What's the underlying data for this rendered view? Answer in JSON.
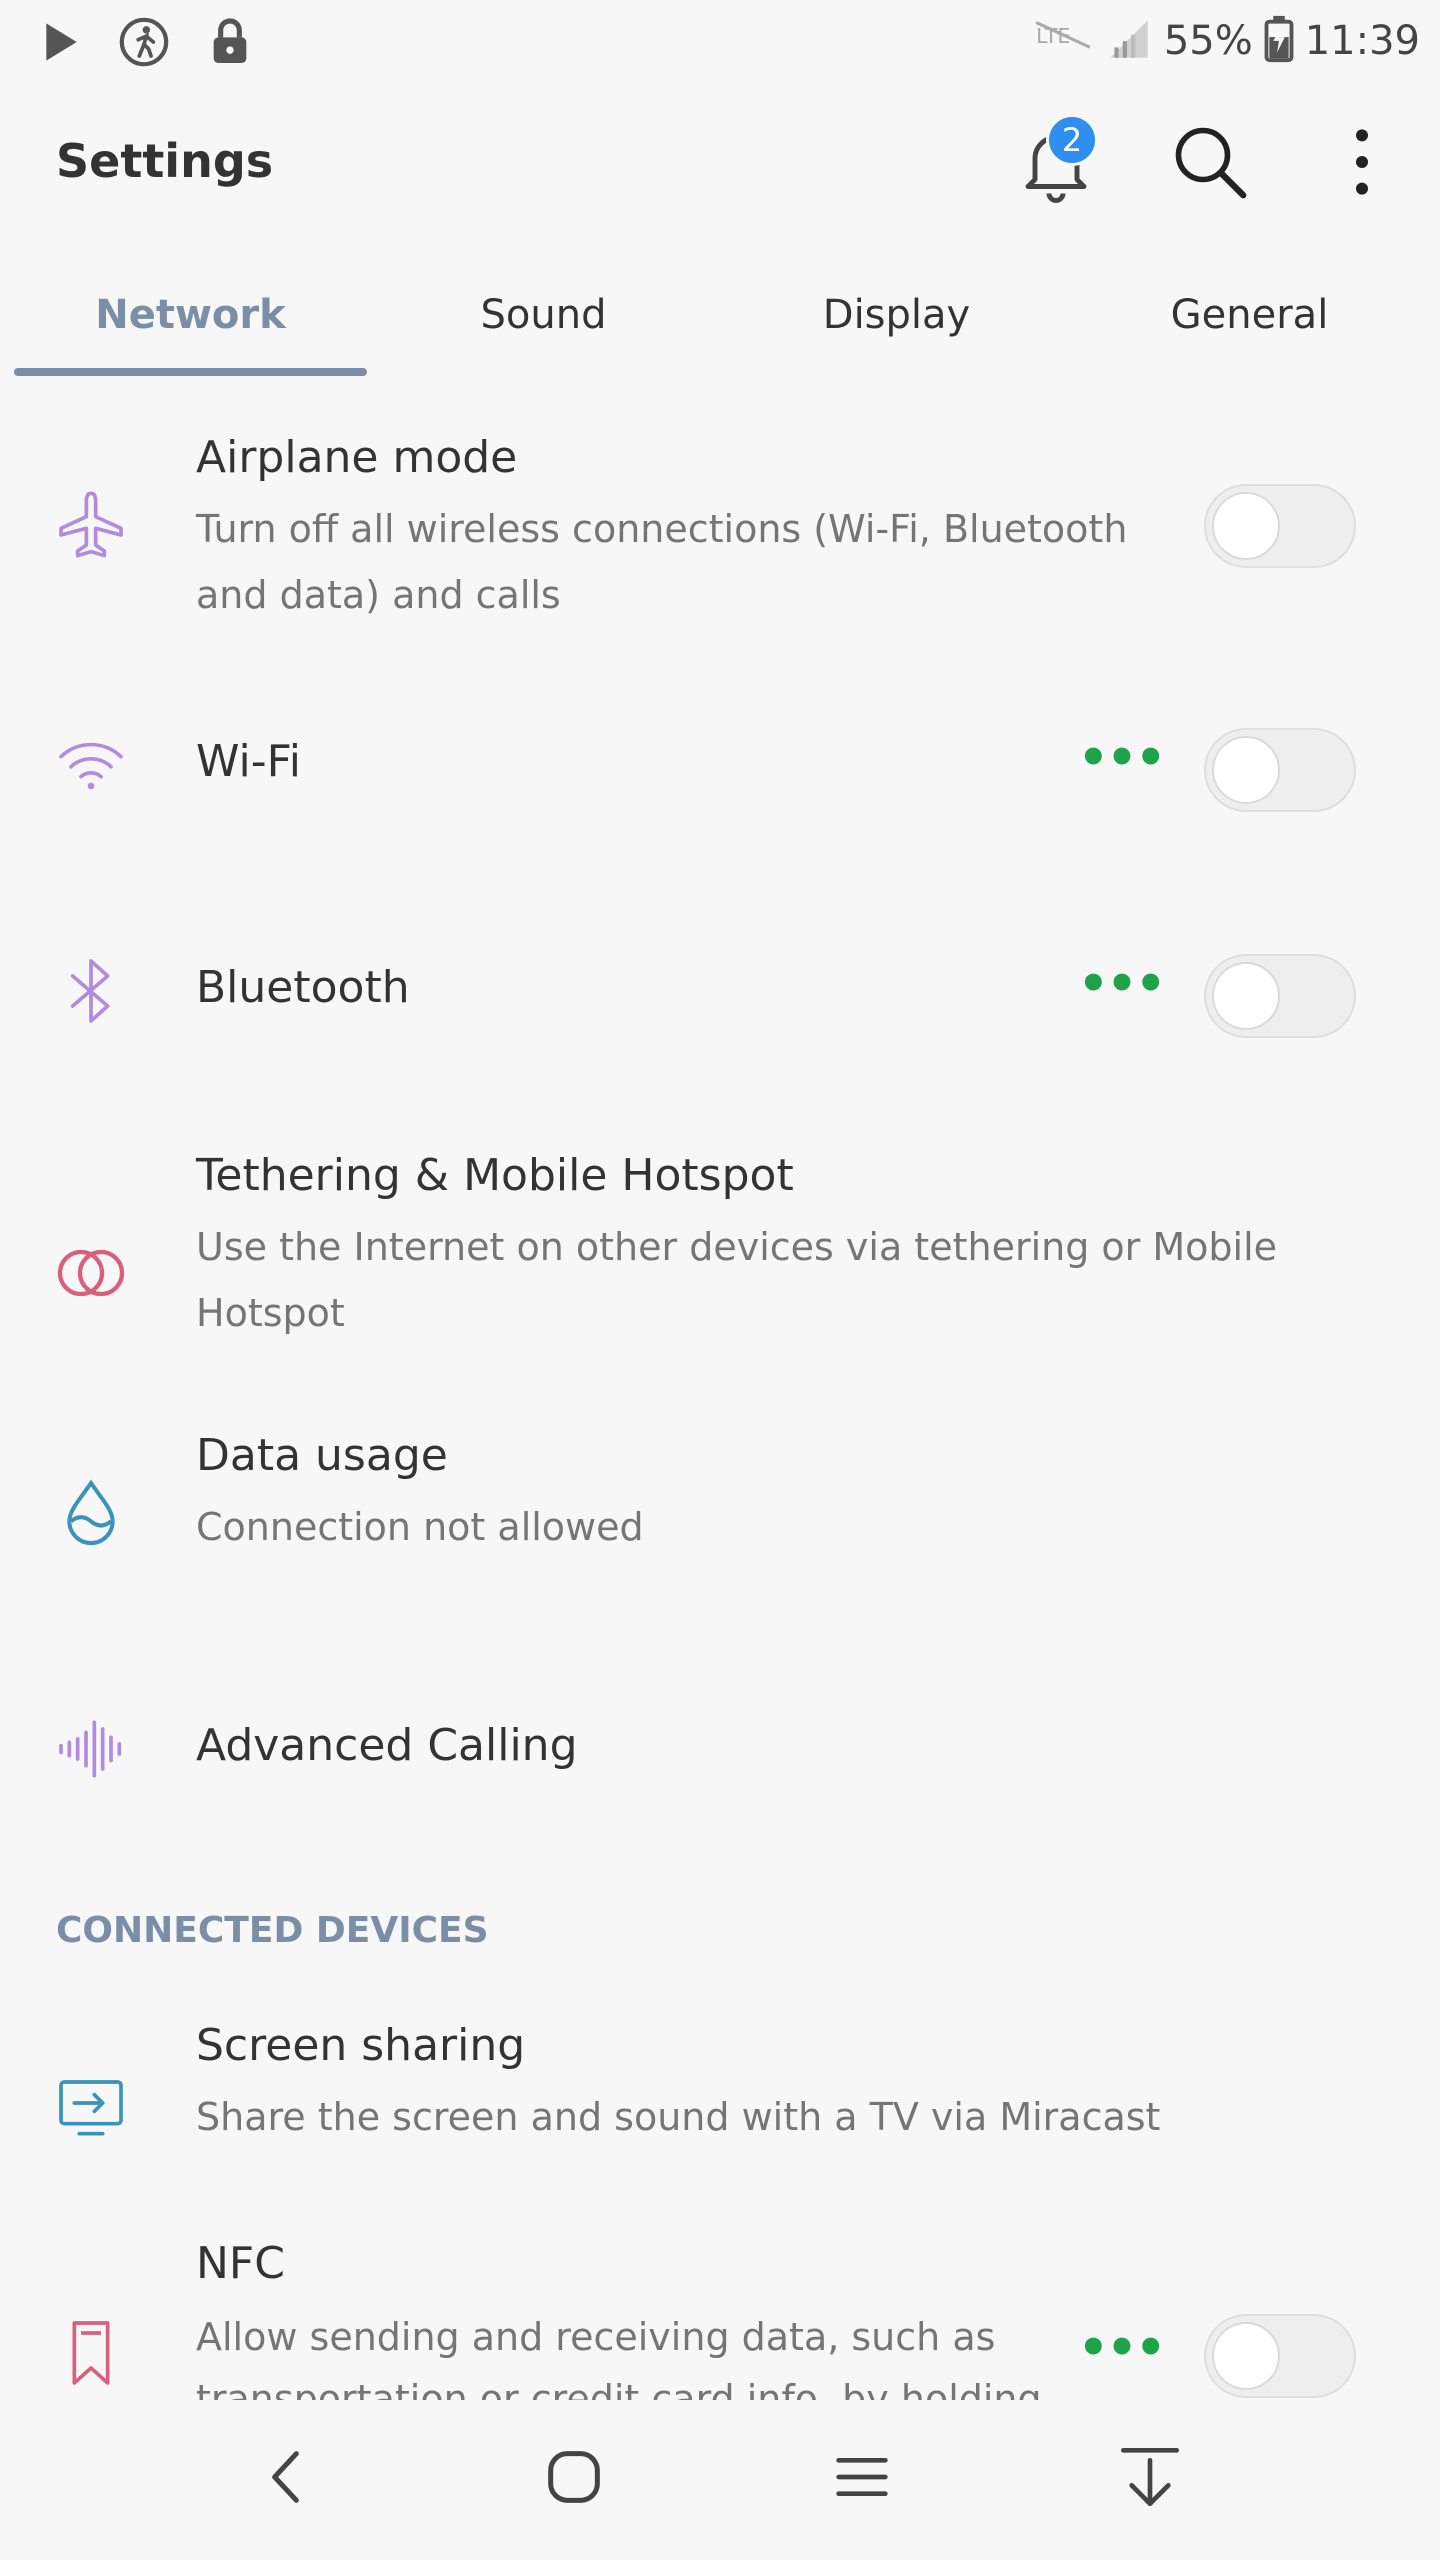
{
  "status_bar": {
    "battery": "55%",
    "time": "11:39"
  },
  "header": {
    "title": "Settings",
    "notification_count": "2"
  },
  "tabs": [
    {
      "label": "Network",
      "active": true
    },
    {
      "label": "Sound",
      "active": false
    },
    {
      "label": "Display",
      "active": false
    },
    {
      "label": "General",
      "active": false
    }
  ],
  "items": {
    "airplane": {
      "title": "Airplane mode",
      "subtitle_line1": "Turn off all wireless connections (Wi-Fi, Bluetooth",
      "subtitle_line2": "and data) and calls",
      "toggle": false
    },
    "wifi": {
      "title": "Wi-Fi",
      "more": "•••",
      "toggle": false
    },
    "bluetooth": {
      "title": "Bluetooth",
      "more": "•••",
      "toggle": false
    },
    "tethering": {
      "title": "Tethering & Mobile Hotspot",
      "subtitle_line1": "Use the Internet on other devices via tethering or Mobile",
      "subtitle_line2": "Hotspot"
    },
    "data_usage": {
      "title": "Data usage",
      "subtitle": "Connection not allowed"
    },
    "advanced_calling": {
      "title": "Advanced Calling"
    }
  },
  "section_connected": {
    "header": "CONNECTED DEVICES",
    "screen_sharing": {
      "title": "Screen sharing",
      "subtitle": "Share the screen and sound with a TV via Miracast"
    },
    "nfc": {
      "title": "NFC",
      "subtitle_line1": "Allow sending and receiving data, such as",
      "subtitle_line2": "transportation or credit card info, by holding",
      "more": "•••",
      "toggle": false
    }
  },
  "colors": {
    "accent": "#7a8ea7",
    "icon_purple": "#b08be0",
    "icon_pink": "#d9607a",
    "icon_teal": "#3a93b8",
    "more_green": "#1fa34a",
    "badge_blue": "#2f8ff0"
  },
  "icons": [
    "play-icon",
    "activity-icon",
    "lock-icon",
    "no-sim-icon",
    "signal-icon",
    "battery-icon",
    "bell-icon",
    "search-icon",
    "more-vert-icon",
    "airplane-icon",
    "wifi-icon",
    "bluetooth-icon",
    "tethering-icon",
    "water-drop-icon",
    "waveform-icon",
    "screen-share-icon",
    "nfc-icon",
    "back-icon",
    "home-icon",
    "recents-icon",
    "hide-keyboard-icon"
  ]
}
